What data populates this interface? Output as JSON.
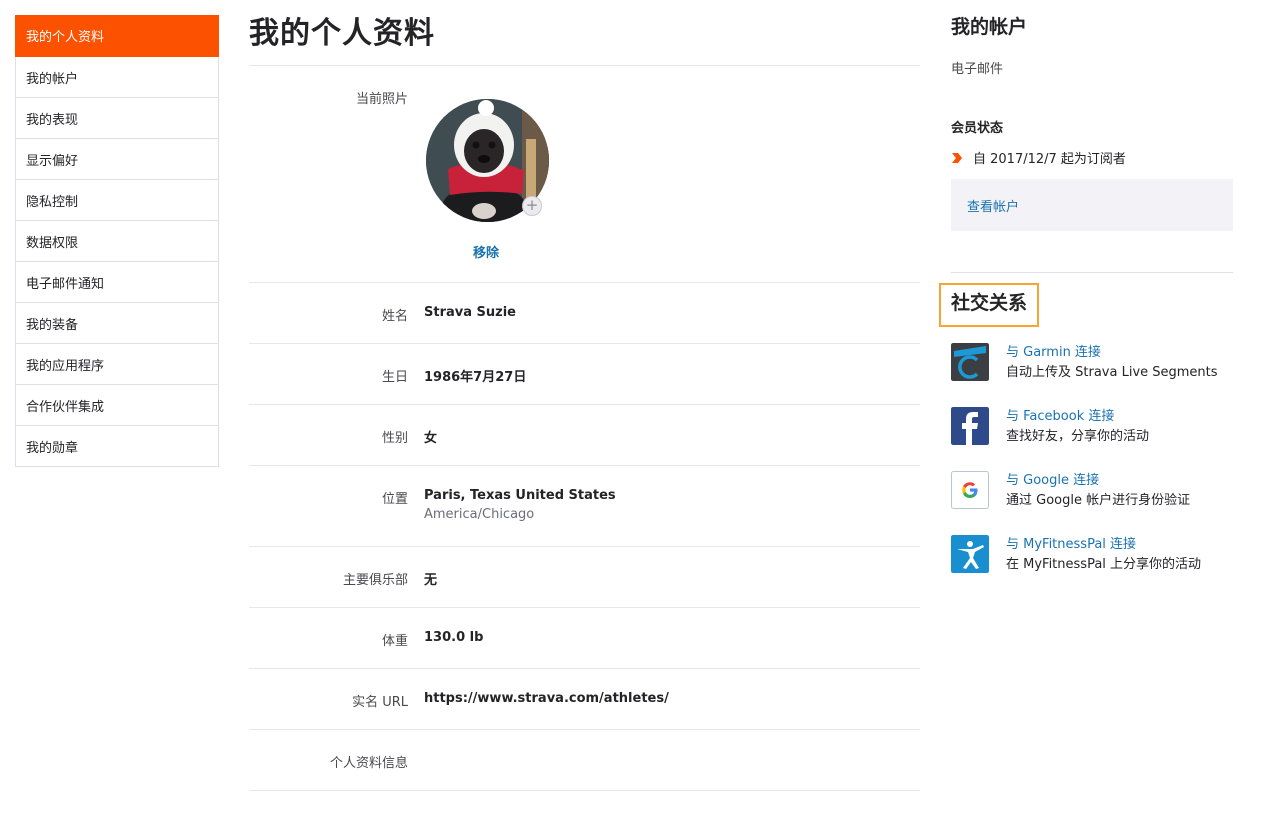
{
  "sidebar": {
    "items": [
      {
        "label": "我的个人资料",
        "active": true
      },
      {
        "label": "我的帐户"
      },
      {
        "label": "我的表现"
      },
      {
        "label": "显示偏好"
      },
      {
        "label": "隐私控制"
      },
      {
        "label": "数据权限"
      },
      {
        "label": "电子邮件通知"
      },
      {
        "label": "我的装备"
      },
      {
        "label": "我的应用程序"
      },
      {
        "label": "合作伙伴集成"
      },
      {
        "label": "我的勋章"
      }
    ]
  },
  "main": {
    "title": "我的个人资料",
    "photo_label": "当前照片",
    "remove_label": "移除",
    "fields": [
      {
        "label": "姓名",
        "value": "Strava Suzie"
      },
      {
        "label": "生日",
        "value": "1986年7月27日"
      },
      {
        "label": "性别",
        "value": "女"
      },
      {
        "label": "位置",
        "value": "Paris, Texas United States",
        "sub": "America/Chicago"
      },
      {
        "label": "主要俱乐部",
        "value": "无"
      },
      {
        "label": "体重",
        "value": "130.0 lb"
      },
      {
        "label": "实名 URL",
        "value": "https://www.strava.com/athletes/"
      },
      {
        "label": "个人资料信息",
        "value": ""
      }
    ]
  },
  "account": {
    "title": "我的帐户",
    "email_label": "电子邮件",
    "membership_title": "会员状态",
    "membership_text": "自 2017/12/7 起为订阅者",
    "view_account": "查看帐户"
  },
  "social": {
    "title": "社交关系",
    "connections": [
      {
        "link": "与 Garmin 连接",
        "desc": "自动上传及 Strava Live Segments",
        "icon": "garmin-icon"
      },
      {
        "link": "与 Facebook 连接",
        "desc": "查找好友，分享你的活动",
        "icon": "facebook-icon"
      },
      {
        "link": "与 Google 连接",
        "desc": "通过 Google 帐户进行身份验证",
        "icon": "google-icon"
      },
      {
        "link": "与 MyFitnessPal 连接",
        "desc": "在 MyFitnessPal 上分享你的活动",
        "icon": "myfitnesspal-icon"
      }
    ]
  },
  "colors": {
    "accent": "#fc5200",
    "link": "#1a72b0",
    "highlight_border": "#f6a530"
  }
}
